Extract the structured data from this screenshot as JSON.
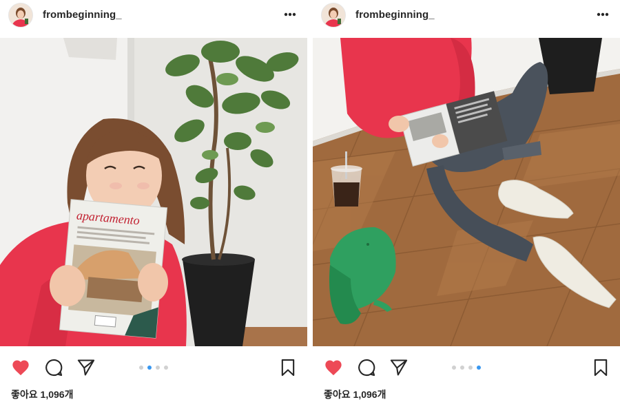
{
  "posts": [
    {
      "username": "frombeginning_",
      "likes_label": "좋아요 1,096개",
      "carousel": {
        "count": 4,
        "active_index": 1
      },
      "photo": {
        "subject": "woman in red sweater holding magazine beside potted plant",
        "magazine_title": "apartamento"
      }
    },
    {
      "username": "frombeginning_",
      "likes_label": "좋아요 1,096개",
      "carousel": {
        "count": 4,
        "active_index": 3
      },
      "photo": {
        "subject": "person sitting on wood floor reading magazine with iced coffee and green cap"
      }
    }
  ],
  "colors": {
    "like_active": "#ed4956",
    "carousel_active": "#3897f0",
    "carousel_inactive": "#d1d1d1",
    "sweater": "#e8354d",
    "text": "#262626"
  },
  "icons": [
    "more-icon",
    "heart-icon",
    "comment-icon",
    "share-icon",
    "bookmark-icon"
  ]
}
